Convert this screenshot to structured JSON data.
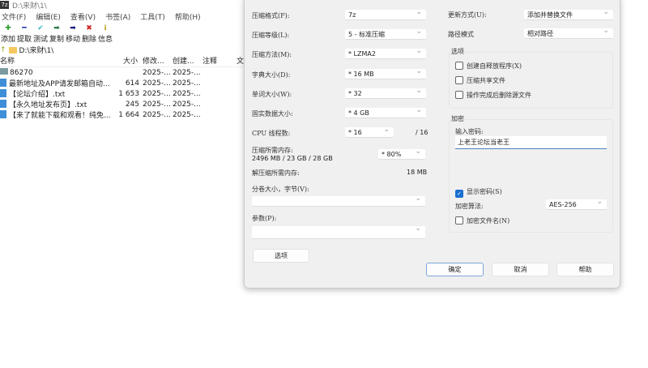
{
  "window": {
    "title": "D:\\来财\\1\\",
    "app_icon": "7z"
  },
  "menu": [
    "文件(F)",
    "编辑(E)",
    "查看(V)",
    "书签(A)",
    "工具(T)",
    "帮助(H)"
  ],
  "toolbar": [
    {
      "label": "添加",
      "icon": "plus-icon",
      "glyph": "✚",
      "color": "#2a9d2a"
    },
    {
      "label": "提取",
      "icon": "minus-icon",
      "glyph": "━",
      "color": "#1a2aa8"
    },
    {
      "label": "测试",
      "icon": "check-icon",
      "glyph": "✔",
      "color": "#3bb8c8"
    },
    {
      "label": "复制",
      "icon": "arrow-right-icon",
      "glyph": "➡",
      "color": "#2a7a4a"
    },
    {
      "label": "移动",
      "icon": "move-arrow-icon",
      "glyph": "➡",
      "color": "#1a1a80"
    },
    {
      "label": "删除",
      "icon": "delete-x-icon",
      "glyph": "✖",
      "color": "#d02020"
    },
    {
      "label": "信息",
      "icon": "info-icon",
      "glyph": "ℹ",
      "color": "#b8a020"
    }
  ],
  "address": "D:\\来财\\1\\",
  "columns": [
    "名称",
    "大小",
    "修改...",
    "创建...",
    "注释",
    "文"
  ],
  "files": [
    {
      "name": "86270",
      "size": "",
      "modified": "2025-...",
      "created": "2025-...",
      "type": "folder"
    },
    {
      "name": "最新地址及APP请发邮箱自动...",
      "size": "614",
      "modified": "2025-...",
      "created": "2025-...",
      "type": "file"
    },
    {
      "name": "【论坛介绍】.txt",
      "size": "1 653",
      "modified": "2025-...",
      "created": "2025-...",
      "type": "file"
    },
    {
      "name": "【永久地址发布页】.txt",
      "size": "245",
      "modified": "2025-...",
      "created": "2025-...",
      "type": "file"
    },
    {
      "name": "【来了就能下载和观看！纯免...",
      "size": "1 664",
      "modified": "2025-...",
      "created": "2025-...",
      "type": "file"
    }
  ],
  "dialog": {
    "format_label": "压缩格式(F):",
    "format": "7z",
    "level_label": "压缩等级(L):",
    "level": "5 - 标准压缩",
    "method_label": "压缩方法(M):",
    "method": "*  LZMA2",
    "dict_label": "字典大小(D):",
    "dict": "*  16 MB",
    "word_label": "单词大小(W):",
    "word": "*  32",
    "solid_label": "固实数据大小:",
    "solid": "*  4 GB",
    "cpu_label": "CPU 线程数:",
    "cpu": "*  16",
    "cpu_max": "/ 16",
    "mem_label": "压缩所需内存:",
    "mem_value": "2496 MB / 23 GB / 28 GB",
    "mem_pct": "* 80%",
    "dmem_label": "解压缩所需内存:",
    "dmem_value": "18 MB",
    "volume_label": "分卷大小，字节(V):",
    "volume": "",
    "params_label": "参数(P):",
    "params": "",
    "options_btn": "选项",
    "update_label": "更新方式(U):",
    "update": "添加并替换文件",
    "path_label": "路径模式",
    "path": "相对路径",
    "options_group": "选项",
    "opt_sfx": "创建自释放程序(X)",
    "opt_shared": "压缩共享文件",
    "opt_delete": "操作完成后删除源文件",
    "enc_group": "加密",
    "pw_label": "输入密码:",
    "password": "上老王论坛当老王",
    "show_pw": "显示密码(S)",
    "show_pw_checked": true,
    "enc_method_label": "加密算法:",
    "enc_method": "AES-256",
    "enc_names": "加密文件名(N)",
    "ok": "确定",
    "cancel": "取消",
    "help": "帮助"
  }
}
